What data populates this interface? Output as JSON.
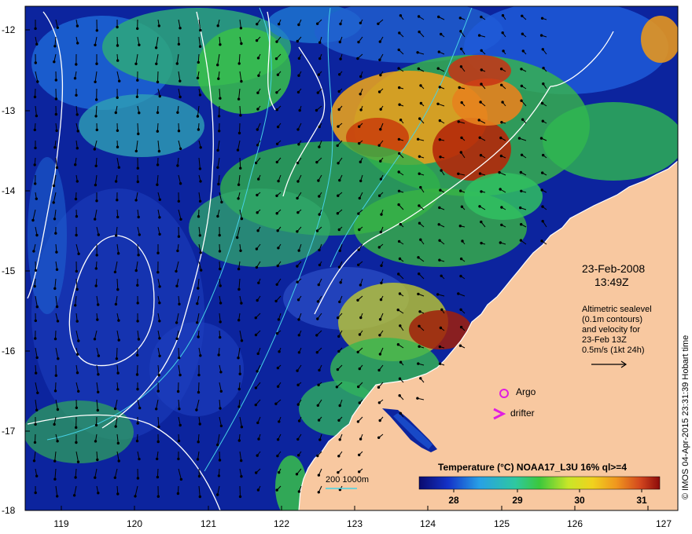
{
  "map": {
    "lat_labels": [
      "-12",
      "-13",
      "-14",
      "-15",
      "-16",
      "-17",
      "-18"
    ],
    "lon_labels": [
      "119",
      "120",
      "121",
      "122",
      "123",
      "124",
      "125",
      "126",
      "127"
    ],
    "date": "23-Feb-2008",
    "time": "13:49Z",
    "altimetry_lines": [
      "Altimetric sealevel",
      "(0.1m contours)",
      "and velocity for",
      "23-Feb 13Z",
      "0.5m/s (1kt 24h)"
    ],
    "legend_argo": "Argo",
    "legend_drifter": "drifter",
    "scale_label": "200  1000m",
    "colorbar_title": "Temperature (°C) NOAA17_L3U 16% ql>=4",
    "colorbar_ticks": [
      "28",
      "29",
      "30",
      "31"
    ],
    "credit": "© IMOS 04-Apr-2015 23:31:39 Hobart time",
    "colors": {
      "ocean_dark": "#0a1e9e",
      "ocean_blue": "#1e5ad8",
      "cyan": "#28b4e6",
      "green": "#32c850",
      "warm": "#f0a01e",
      "hot": "#b41e0a",
      "land": "#f8c8a0",
      "argo": "#e01ee0"
    }
  }
}
